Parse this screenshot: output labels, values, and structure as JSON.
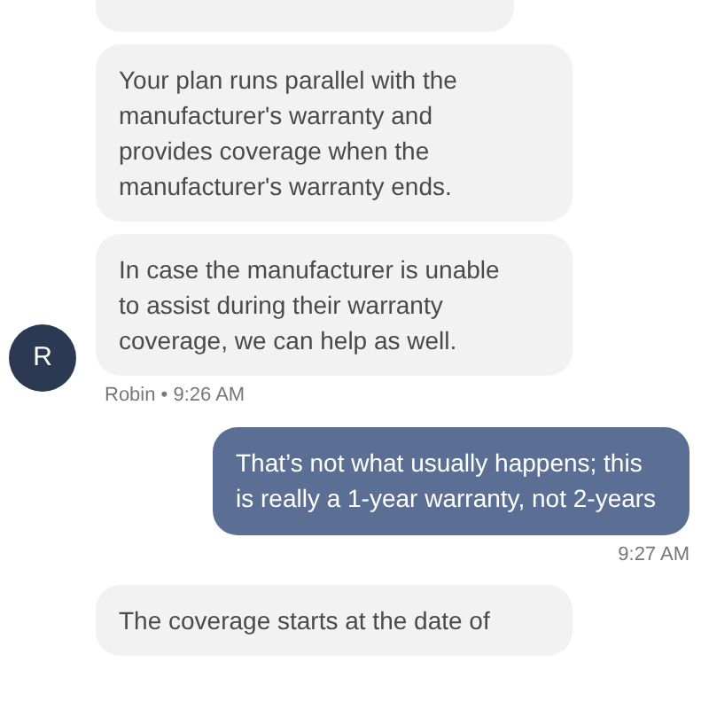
{
  "messages": [
    {
      "kind": "incoming"
    },
    {
      "kind": "incoming",
      "text": "Your plan runs parallel with the manufacturer's warranty and provides coverage when the manufacturer's warranty ends."
    },
    {
      "kind": "incoming",
      "text": "In case the manufacturer is unable to assist during their warranty coverage, we can help as well.",
      "avatar": "R",
      "meta": "Robin • 9:26 AM"
    },
    {
      "kind": "outgoing",
      "text": "That’s not what usually happens; this is really a 1-year warranty, not 2-years",
      "meta": "9:27 AM"
    },
    {
      "kind": "incoming",
      "text": "The coverage starts at the date of"
    }
  ]
}
